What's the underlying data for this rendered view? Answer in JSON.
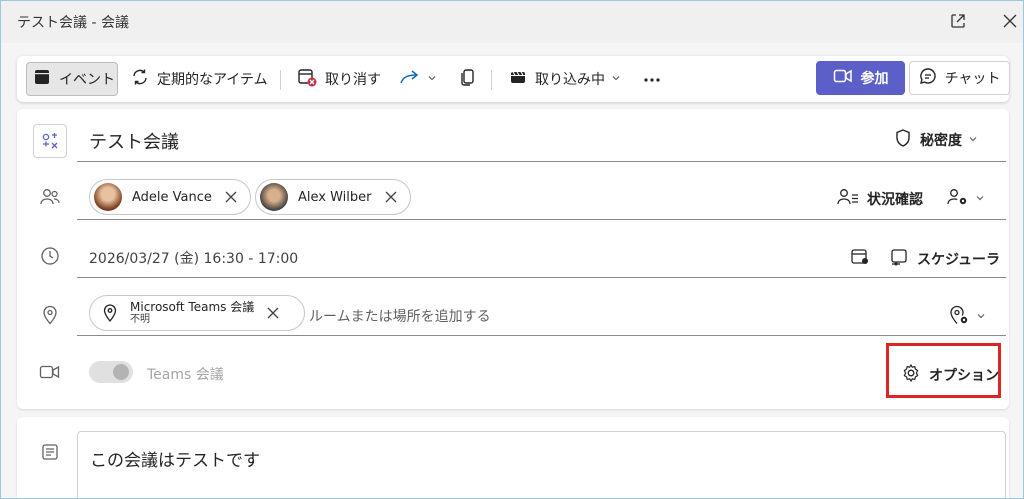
{
  "window": {
    "title": "テスト会議 - 会議",
    "popout_icon": "popout-icon",
    "close_icon": "close-icon"
  },
  "toolbar": {
    "event_label": "イベント",
    "recurring_label": "定期的なアイテム",
    "cancel_label": "取り消す",
    "capture_label": "取り込み中",
    "join_label": "参加",
    "chat_label": "チャット"
  },
  "form": {
    "title": "テスト会議",
    "sensitivity_label": "秘密度",
    "attendees": [
      {
        "name": "Adele Vance"
      },
      {
        "name": "Alex Wilber"
      }
    ],
    "status_label": "状況確認",
    "datetime": "2026/03/27 (金) 16:30 - 17:00",
    "scheduler_label": "スケジューラ",
    "location_chip_title": "Microsoft Teams 会議",
    "location_chip_sub": "不明",
    "location_placeholder": "ルームまたは場所を追加する",
    "teams_meeting_label": "Teams 会議",
    "options_label": "オプション"
  },
  "body": {
    "text": "この会議はテストです"
  },
  "colors": {
    "accent": "#5b5fc7",
    "highlight": "#e02424",
    "cancel_icon_badge": "#c4314b"
  }
}
